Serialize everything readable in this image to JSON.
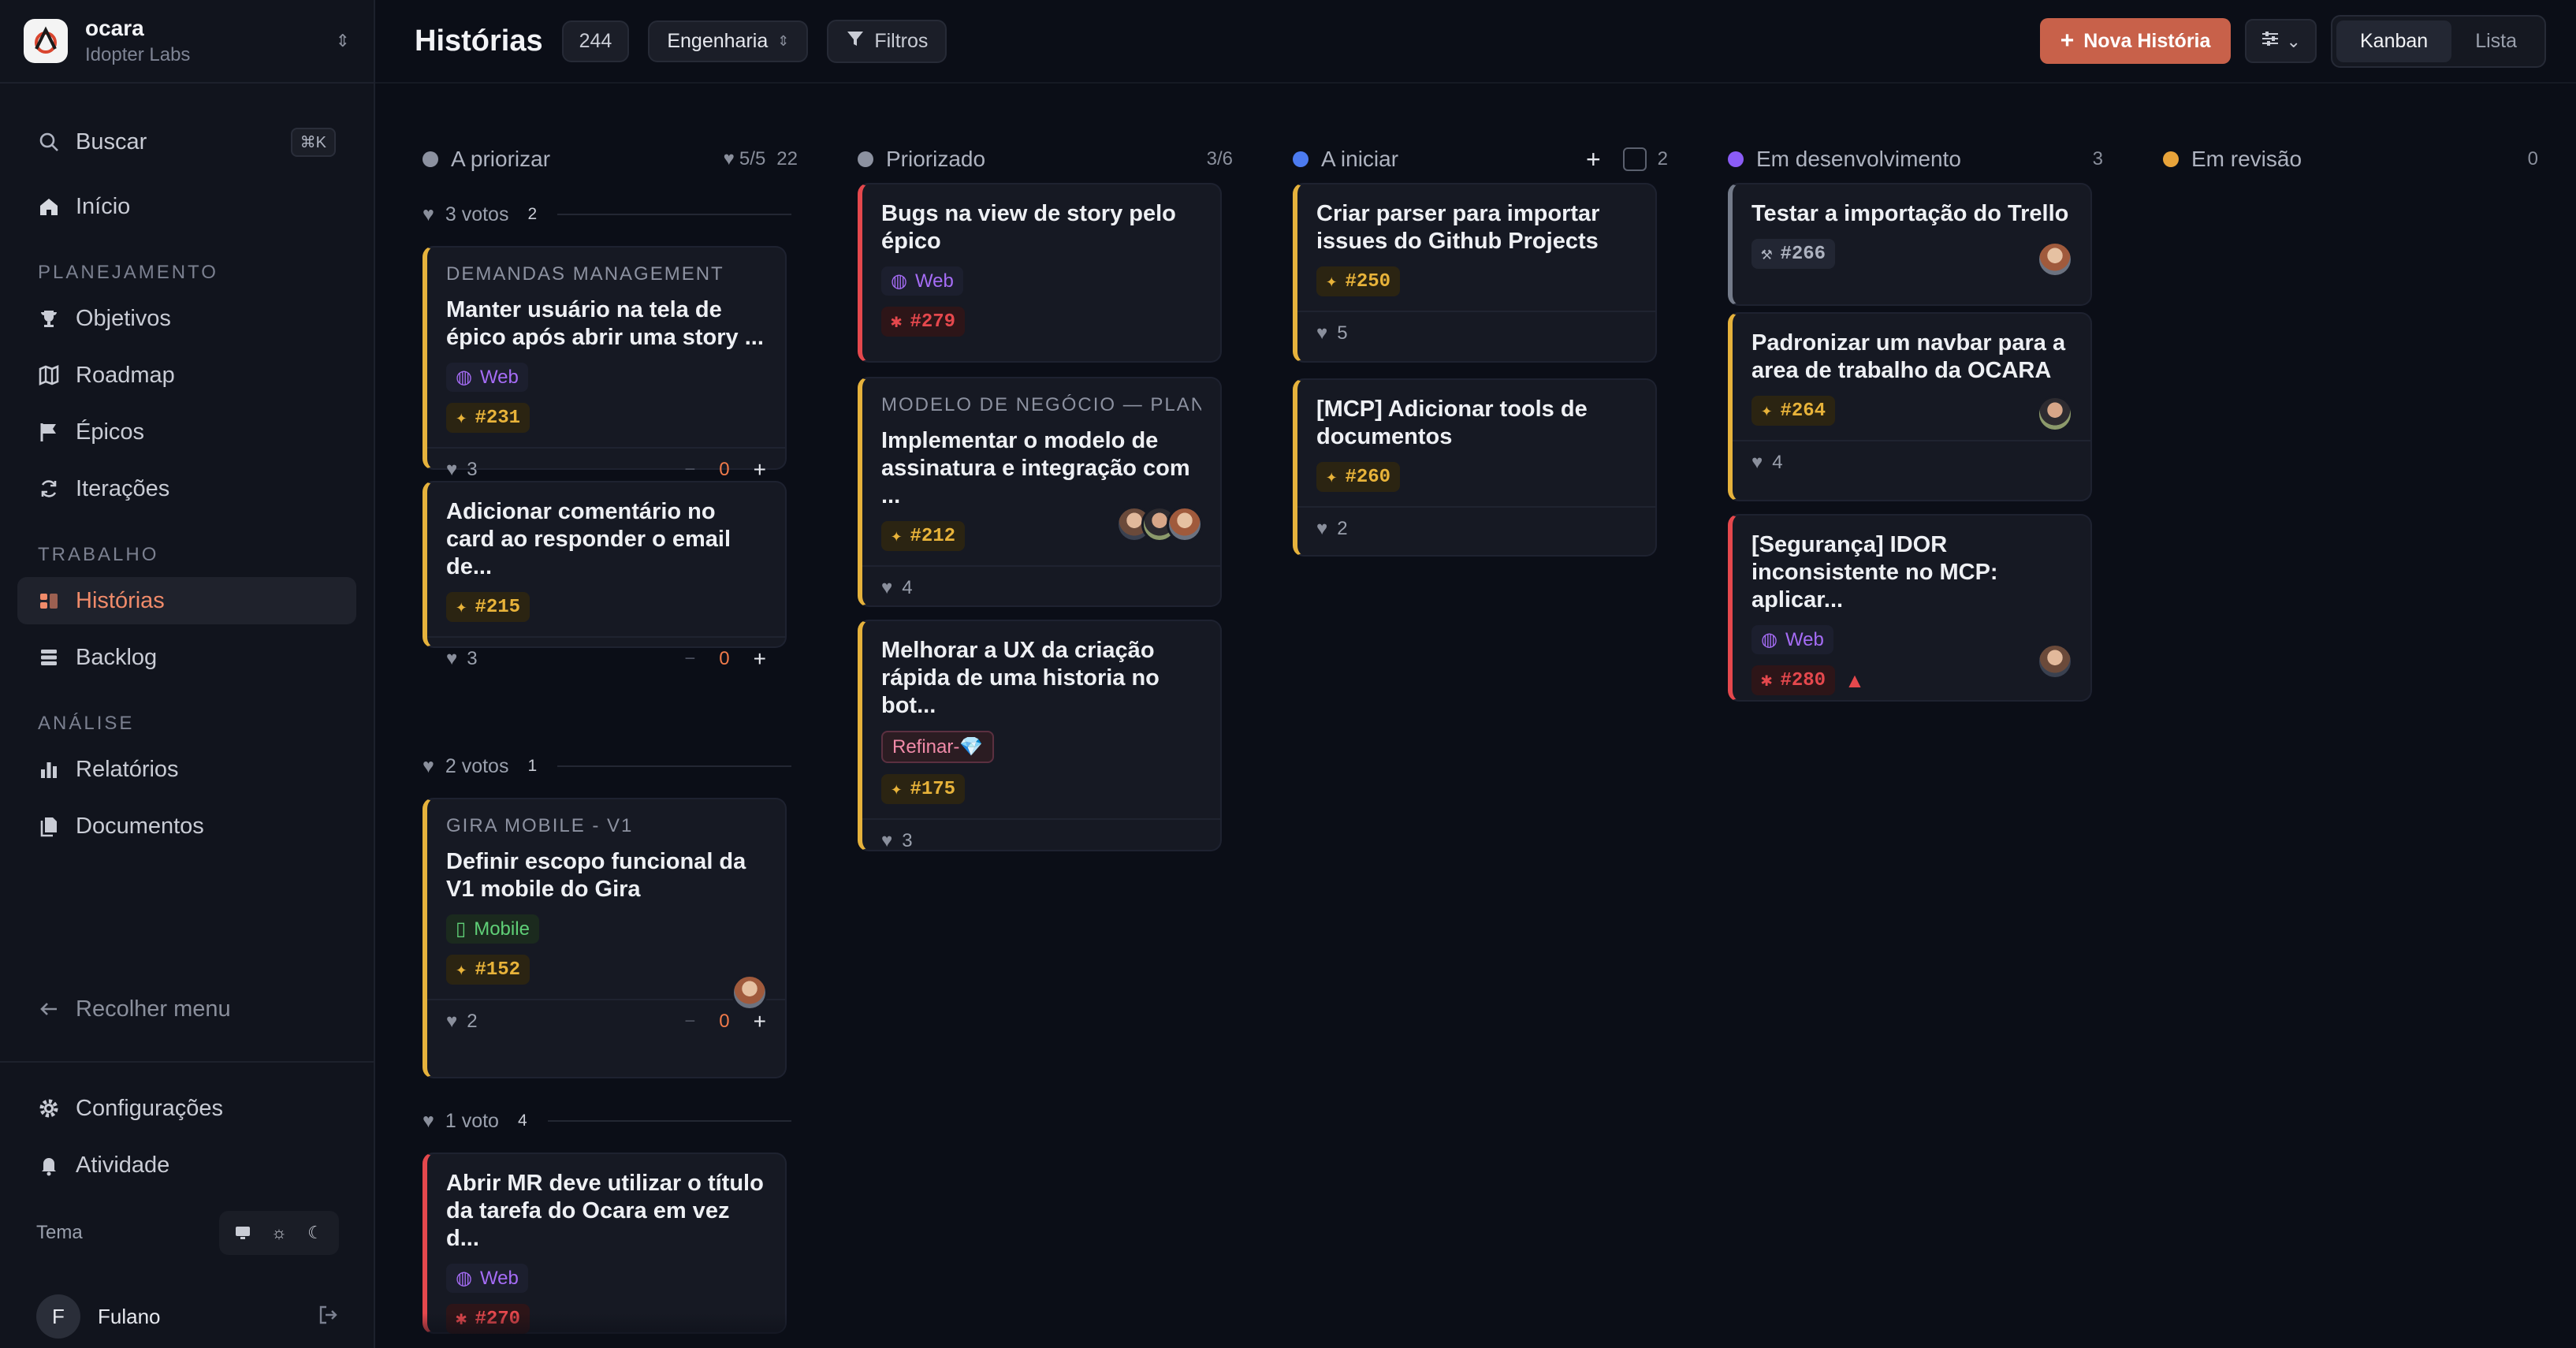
{
  "workspace": {
    "name": "ocara",
    "subtitle": "Idopter Labs"
  },
  "sidebar": {
    "search": {
      "label": "Buscar",
      "shortcut": "⌘K"
    },
    "home": "Início",
    "sections": [
      {
        "title": "PLANEJAMENTO",
        "items": [
          "Objetivos",
          "Roadmap",
          "Épicos",
          "Iterações"
        ]
      },
      {
        "title": "TRABALHO",
        "items": [
          "Histórias",
          "Backlog"
        ]
      },
      {
        "title": "ANÁLISE",
        "items": [
          "Relatórios",
          "Documentos"
        ]
      }
    ],
    "active_item": "Histórias",
    "collapse": "Recolher menu",
    "settings": "Configurações",
    "activity": "Atividade",
    "theme_label": "Tema",
    "user": {
      "initial": "F",
      "name": "Fulano"
    }
  },
  "header": {
    "title": "Histórias",
    "count": "244",
    "team": "Engenharia",
    "filters": "Filtros",
    "new_story": "Nova História",
    "views": [
      "Kanban",
      "Lista"
    ],
    "active_view": "Kanban"
  },
  "columns": [
    {
      "name": "A priorizar",
      "dot": "#8c91a0",
      "meta_votes": "5/5",
      "count": "22",
      "groups": [
        {
          "label": "3 votos",
          "count": "2",
          "cards": [
            {
              "epic": "DEMANDAS MANAGEMENT",
              "title": "Manter usuário na tela de épico após abrir uma story ...",
              "tag": "Web",
              "issue": "#231",
              "votes": "3",
              "score": "0"
            },
            {
              "epic": "",
              "title": "Adicionar comentário no card ao responder o email de...",
              "tag": "",
              "issue": "#215",
              "votes": "3",
              "score": "0"
            }
          ]
        },
        {
          "label": "2 votos",
          "count": "1",
          "cards": [
            {
              "epic": "GIRA MOBILE - V1",
              "title": "Definir escopo funcional da V1 mobile do Gira",
              "tag": "Mobile",
              "issue": "#152",
              "votes": "2",
              "score": "0"
            }
          ]
        },
        {
          "label": "1 voto",
          "count": "4",
          "cards": [
            {
              "epic": "",
              "title": "Abrir MR deve utilizar o título da tarefa do Ocara em vez d...",
              "tag": "Web",
              "issue": "#270"
            }
          ]
        }
      ]
    },
    {
      "name": "Priorizado",
      "dot": "#8c91a0",
      "count": "3/6",
      "cards": [
        {
          "title": "Bugs na view de story pelo épico",
          "tag": "Web",
          "issue": "#279"
        },
        {
          "epic": "MODELO DE NEGÓCIO — PLAN...",
          "title": "Implementar o modelo de assinatura e integração com ...",
          "issue": "#212",
          "votes": "4"
        },
        {
          "title": "Melhorar a UX da criação rápida de uma historia no bot...",
          "tag": "Refinar-💎",
          "issue": "#175",
          "votes": "3"
        }
      ]
    },
    {
      "name": "A iniciar",
      "dot": "#4c7bf0",
      "count": "2",
      "cards": [
        {
          "title": "Criar parser para importar issues do Github Projects",
          "issue": "#250",
          "votes": "5"
        },
        {
          "title": "[MCP] Adicionar tools de documentos",
          "issue": "#260",
          "votes": "2"
        }
      ]
    },
    {
      "name": "Em desenvolvimento",
      "dot": "#8b5cf6",
      "count": "3",
      "cards": [
        {
          "title": "Testar a importação do Trello",
          "issue": "#266"
        },
        {
          "title": "Padronizar um navbar para a area de trabalho da OCARA",
          "issue": "#264",
          "votes": "4"
        },
        {
          "title": "[Segurança] IDOR inconsistente no MCP: aplicar...",
          "tag": "Web",
          "issue": "#280"
        }
      ]
    },
    {
      "name": "Em revisão",
      "dot": "#e8a33a",
      "count": "0",
      "cards": []
    }
  ]
}
